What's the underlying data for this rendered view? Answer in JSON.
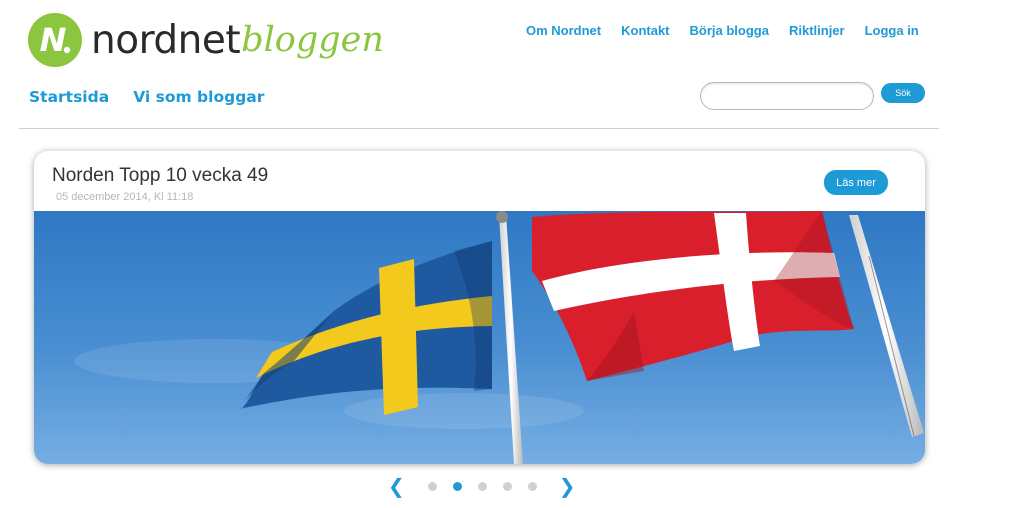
{
  "logo": {
    "brand": "nordnet",
    "product": "bloggen",
    "mark_letter": "N"
  },
  "top_nav": [
    "Om Nordnet",
    "Kontakt",
    "Börja blogga",
    "Riktlinjer",
    "Logga in"
  ],
  "main_nav": [
    "Startsida",
    "Vi som bloggar"
  ],
  "search": {
    "value": "",
    "placeholder": "",
    "button_label": "Sök"
  },
  "featured_post": {
    "title": "Norden Topp 10 vecka 49",
    "date": "05 december 2014, Kl 11:18",
    "read_more_label": "Läs mer"
  },
  "carousel": {
    "prev_glyph": "❮",
    "next_glyph": "❯",
    "slide_count": 5,
    "active_slide": 2
  },
  "colors": {
    "accent_blue": "#1e9ad6",
    "logo_green": "#8cc63f",
    "swedish_blue": "#1f5aa0",
    "swedish_yellow": "#f4c91e",
    "danish_red": "#d91e2c",
    "sky": "#4a8fd2"
  },
  "icons": {
    "logo_mark": "nordnet-logo-icon",
    "prev": "chevron-left-icon",
    "next": "chevron-right-icon"
  }
}
